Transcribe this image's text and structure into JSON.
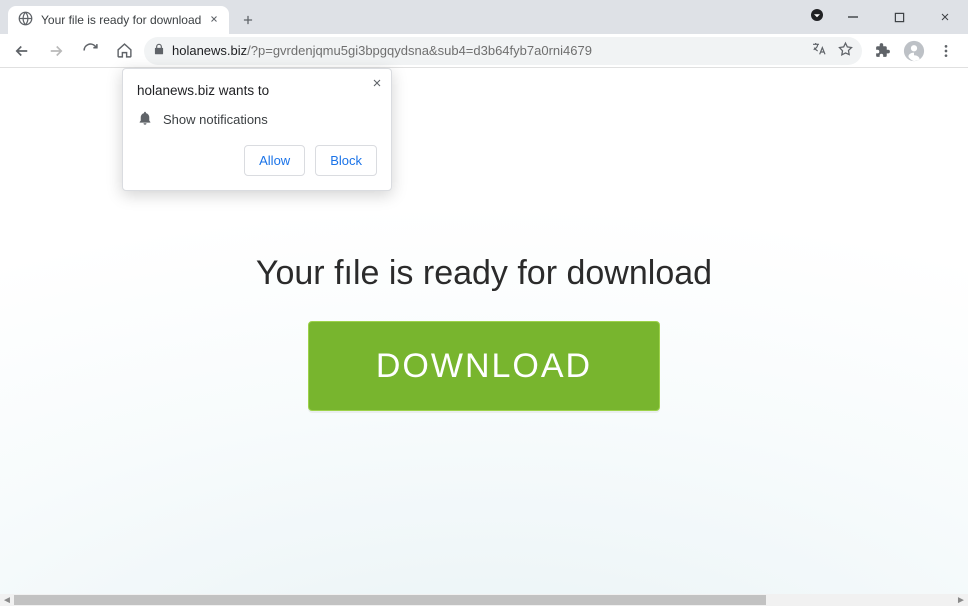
{
  "window": {
    "tab_title": "Your file is ready for download"
  },
  "address": {
    "host": "holanews.biz",
    "path": "/?p=gvrdenjqmu5gi3bpgqydsna&sub4=d3b64fyb7a0rni4679"
  },
  "page": {
    "headline": "Your fıle is ready for download",
    "download_button": "DOWNLOAD"
  },
  "prompt": {
    "title": "holanews.biz wants to",
    "permission": "Show notifications",
    "allow": "Allow",
    "block": "Block"
  },
  "scrollbar": {
    "thumb_percent": 80
  }
}
